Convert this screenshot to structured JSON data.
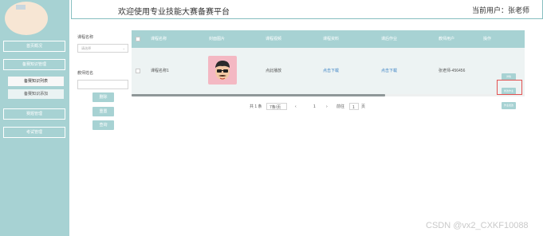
{
  "header": {
    "title": "欢迎使用专业技能大赛备赛平台",
    "user": "当前用户：张老师"
  },
  "avatar": {
    "alt": ""
  },
  "sidebar": {
    "items": [
      {
        "label": "首页概况"
      },
      {
        "label": "备赛知识管理"
      },
      {
        "label": "赛题管理"
      },
      {
        "label": "考试管理"
      }
    ],
    "subitems": [
      {
        "label": "备赛知识列表"
      },
      {
        "label": "备赛知识添加"
      }
    ]
  },
  "filter": {
    "course_label": "课程名称",
    "course_placeholder": "请选择",
    "teacher_label": "教师姓名",
    "teacher_value": "",
    "buttons": [
      {
        "label": "删除"
      },
      {
        "label": "重置"
      },
      {
        "label": "查询"
      }
    ]
  },
  "table": {
    "columns": [
      "课程名称",
      "封面图片",
      "课程视频",
      "课程资料",
      "课后作业",
      "教师用户",
      "操作"
    ],
    "rows": [
      {
        "course": "课程名称1",
        "video": "点此播放",
        "material": "点击下载",
        "homework": "点击下载",
        "teacher": "张老师-456456",
        "actions": [
          "详情",
          "修改作业",
          "作业批改"
        ]
      }
    ]
  },
  "pagination": {
    "total": "共 1 条",
    "page_size": "7条/页",
    "prev": "‹",
    "current": "1",
    "next": "›",
    "goto_label": "前往",
    "goto_value": "1",
    "page_unit": "页"
  },
  "watermark": "CSDN @vx2_CXKF10088",
  "colors": {
    "teal": "#a7d2d3",
    "link": "#3b82c4",
    "highlight": "#e35252",
    "cover": "#f4b8c3"
  },
  "icons": {
    "cover_image": "cartoon-face-with-sunglasses",
    "select_chevron": "chevron-down-icon"
  }
}
